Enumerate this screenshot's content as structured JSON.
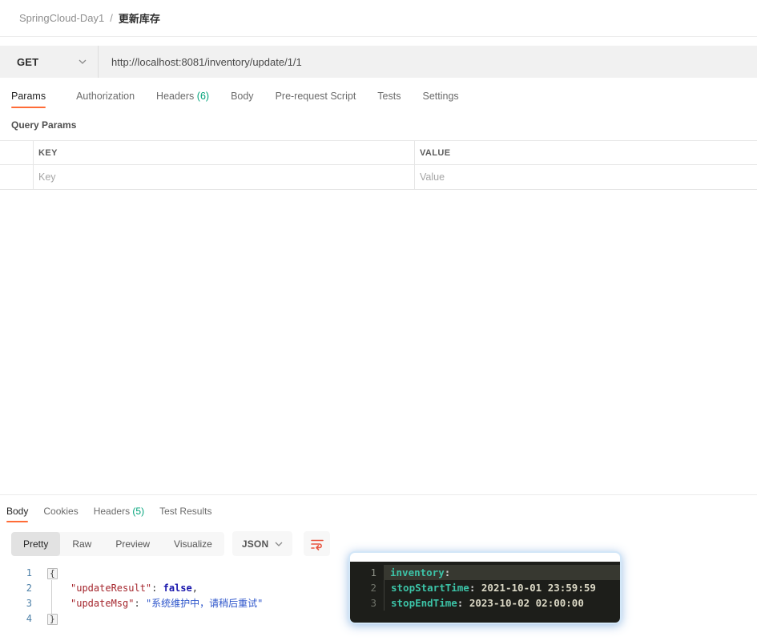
{
  "breadcrumb": {
    "collection": "SpringCloud-Day1",
    "separator": "/",
    "request": "更新库存"
  },
  "request_bar": {
    "method": "GET",
    "url": "http://localhost:8081/inventory/update/1/1"
  },
  "request_tabs": [
    {
      "label": "Params",
      "active": true
    },
    {
      "label": "Authorization"
    },
    {
      "label": "Headers",
      "count": "(6)"
    },
    {
      "label": "Body"
    },
    {
      "label": "Pre-request Script"
    },
    {
      "label": "Tests"
    },
    {
      "label": "Settings"
    }
  ],
  "query_params": {
    "title": "Query Params",
    "columns": [
      "KEY",
      "VALUE"
    ],
    "placeholder_row": {
      "key": "Key",
      "value": "Value"
    }
  },
  "response": {
    "tabs": [
      {
        "label": "Body",
        "active": true
      },
      {
        "label": "Cookies"
      },
      {
        "label": "Headers",
        "count": "(5)"
      },
      {
        "label": "Test Results"
      }
    ],
    "view_modes": [
      {
        "label": "Pretty",
        "active": true
      },
      {
        "label": "Raw"
      },
      {
        "label": "Preview"
      },
      {
        "label": "Visualize"
      }
    ],
    "format_select": "JSON",
    "body_lines": [
      {
        "number": "1",
        "brace": "{"
      },
      {
        "number": "2",
        "key": "\"updateResult\"",
        "sep": ": ",
        "value": "false",
        "comma": ","
      },
      {
        "number": "3",
        "key": "\"updateMsg\"",
        "sep": ": ",
        "value": "\"系统维护中，请稍后重试\""
      },
      {
        "number": "4",
        "brace": "}"
      }
    ]
  },
  "overlay": {
    "lines": [
      {
        "number": "1",
        "key": "inventory",
        "sep": ":",
        "value": ""
      },
      {
        "number": "2",
        "key": "stopStartTime",
        "sep": ": ",
        "value": "2021-10-01 23:59:59"
      },
      {
        "number": "3",
        "key": "stopEndTime",
        "sep": ": ",
        "value": "2023-10-02 02:00:00"
      }
    ]
  },
  "colors": {
    "accent_orange": "#ff6c37",
    "count_green": "#00a37a",
    "json_key_red": "#a5262d",
    "json_string_blue": "#2e56cb",
    "json_atom_blue": "#1b18ad",
    "line_number_blue": "#4d80a8",
    "overlay_bg_dark": "#1d1e1a",
    "overlay_key_teal": "#3cc3a7",
    "overlay_value_cream": "#dbd8c5"
  }
}
